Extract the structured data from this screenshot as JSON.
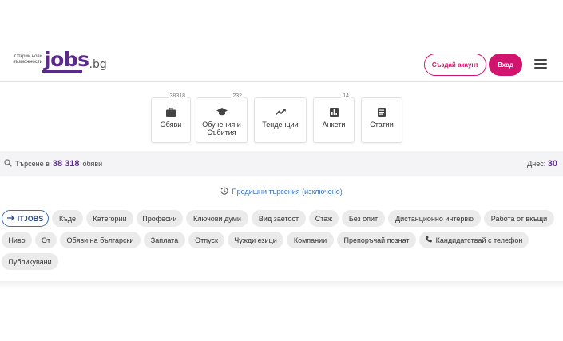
{
  "header": {
    "slogan": "Открий нови възможности",
    "logo_main": "jobs",
    "logo_suffix": ".bg",
    "signup_label": "Създай акаунт",
    "login_label": "Вход"
  },
  "tiles": [
    {
      "label": "Обяви",
      "count": "38318",
      "icon": "briefcase-icon"
    },
    {
      "label": "Обучения и Събития",
      "count": "232",
      "icon": "graduation-cap-icon"
    },
    {
      "label": "Тенденции",
      "count": "",
      "icon": "trending-icon"
    },
    {
      "label": "Анкети",
      "count": "14",
      "icon": "bar-chart-icon"
    },
    {
      "label": "Статии",
      "count": "",
      "icon": "article-icon"
    }
  ],
  "search": {
    "prefix": "Търсене в",
    "count": "38 318",
    "suffix": "обяви",
    "today_label": "Днес:",
    "today_count": "30"
  },
  "previous_searches": "Предишни търсения (изключено)",
  "filters": {
    "itjobs": "ITJOBS",
    "row1": [
      "Къде",
      "Категории",
      "Професии",
      "Ключови думи",
      "Вид заетост",
      "Стаж",
      "Без опит",
      "Дистанционно интервю",
      "Работа от вкъщи"
    ],
    "row2": [
      "Ниво",
      "От",
      "Обяви на български",
      "Заплата",
      "Отпуск",
      "Чужди езици",
      "Компании",
      "Препоръчай познат",
      "Кандидатствай с телефон"
    ],
    "row3": [
      "Публикувани"
    ]
  },
  "colors": {
    "brand_purple": "#5b2b8c",
    "accent_pink": "#d1146e",
    "link_blue": "#3a6fb5"
  }
}
